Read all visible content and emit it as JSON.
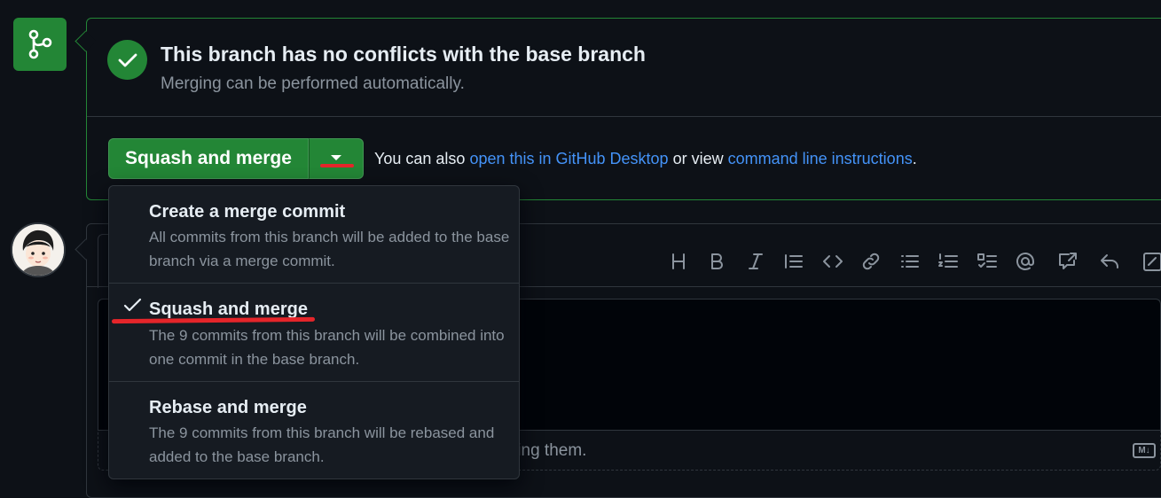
{
  "merge_status": {
    "title": "This branch has no conflicts with the base branch",
    "subtitle": "Merging can be performed automatically."
  },
  "merge_actions": {
    "merge_button_label": "Squash and merge",
    "also_prefix": "You can also",
    "desktop_link": "open this in GitHub Desktop",
    "or_view": "or view",
    "cli_link": "command line instructions",
    "period": "."
  },
  "merge_options": [
    {
      "title": "Create a merge commit",
      "description": "All commits from this branch will be added to the base branch via a merge commit.",
      "selected": false
    },
    {
      "title": "Squash and merge",
      "description": "The 9 commits from this branch will be combined into one commit in the base branch.",
      "selected": true
    },
    {
      "title": "Rebase and merge",
      "description": "The 9 commits from this branch will be rebased and added to the base branch.",
      "selected": false
    }
  ],
  "editor": {
    "footer_text": "ting them.",
    "markdown_badge": "M↓",
    "toolbar_icons": [
      "heading-icon",
      "bold-icon",
      "italic-icon",
      "quote-icon",
      "code-icon",
      "link-icon",
      "unordered-list-icon",
      "ordered-list-icon",
      "task-list-icon",
      "mention-icon",
      "cross-reference-icon",
      "saved-reply-icon",
      "fullscreen-icon"
    ]
  },
  "colors": {
    "background": "#0d1117",
    "success_green": "#238636",
    "link_blue": "#4493f8",
    "muted_text": "#8b949e",
    "annotation_red": "#e5252a"
  }
}
